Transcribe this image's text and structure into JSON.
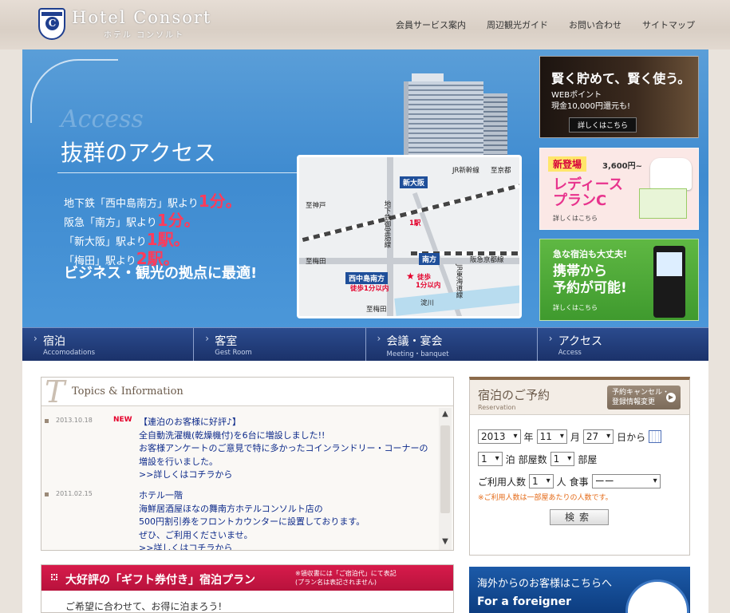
{
  "header": {
    "logo_text": "Hotel Consort",
    "logo_sub": "ホテル コンソルト",
    "nav": [
      "会員サービス案内",
      "周辺観光ガイド",
      "お問い合わせ",
      "サイトマップ"
    ]
  },
  "hero": {
    "script_word": "Access",
    "title": "抜群のアクセス",
    "lines": [
      {
        "pre": "地下鉄「西中島南方」駅より",
        "big": "1分。"
      },
      {
        "pre": "阪急「南方」駅より",
        "big": "1分。"
      },
      {
        "pre": "「新大阪」駅より",
        "big": "1駅。"
      },
      {
        "pre": "「梅田」駅より",
        "big": "2駅。"
      }
    ],
    "tagline": "ビジネス・観光の拠点に最適!",
    "map": {
      "shin_osaka": "新大阪",
      "jr_shinkansen": "JR新幹線",
      "to_kyoto": "至京都",
      "to_kobe": "至神戸",
      "to_umeda_left": "至梅田",
      "subway": "地下鉄御堂筋線",
      "one_station": "1駅",
      "minamikata": "南方",
      "hankyu": "阪急京都線",
      "jr_tokaido": "JR東海道線",
      "nishinakajima": "西中島南方",
      "walk1": "徒歩1分以内",
      "walk2_a": "徒歩",
      "walk2_b": "1分以内",
      "to_umeda_bottom": "至梅田",
      "yodogawa": "淀川"
    }
  },
  "banners": {
    "b1": {
      "title": "賢く貯めて、賢く使う。",
      "line1": "WEBポイント",
      "line2": "現金10,000円還元も!",
      "more": "詳しくはこちら"
    },
    "b2": {
      "badge": "新登場",
      "price": "3,600円~",
      "line1": "レディース",
      "line2": "プランC",
      "more": "詳しくはこちら"
    },
    "b3": {
      "title": "急な宿泊も大丈夫!",
      "line1": "携帯から",
      "line2": "予約が可能!",
      "more": "詳しくはこちら"
    }
  },
  "navbar": [
    {
      "jp": "宿泊",
      "en": "Accomodations"
    },
    {
      "jp": "客室",
      "en": "Gest Room"
    },
    {
      "jp": "会議・宴会",
      "en": "Meeting・banquet"
    },
    {
      "jp": "アクセス",
      "en": "Access"
    }
  ],
  "topics": {
    "title": "Topics & Information",
    "items": [
      {
        "date": "2013.10.18",
        "new": "NEW",
        "lines": [
          "【連泊のお客様に好評♪】",
          "全自動洗濯機(乾燥機付)を6台に増設しました!!",
          "お客様アンケートのご意見で特に多かったコインランドリー・コーナーの",
          "増設を行いました。",
          ">>詳しくはコチラから"
        ]
      },
      {
        "date": "2011.02.15",
        "new": "",
        "lines": [
          "ホテル一階",
          "海鮮居酒屋ほなの舞南方ホテルコンソルト店の",
          "500円割引券をフロントカウンターに設置しております。",
          "ぜひ、ご利用くださいませ。",
          ">>詳しくはコチラから"
        ]
      }
    ]
  },
  "gift": {
    "title": "大好評の「ギフト券付き」宿泊プラン",
    "note1": "※領収書には「ご宿泊代」にて表記",
    "note2": "(プラン名は表記されません)",
    "sub": "ご希望に合わせて、お得に泊まろう!"
  },
  "reservation": {
    "title": "宿泊のご予約",
    "sub": "Reservation",
    "cancel_line1": "予約キャンセル・",
    "cancel_line2": "登録情報変更",
    "year": "2013",
    "year_label": "年",
    "month": "11",
    "month_label": "月",
    "day": "27",
    "day_label": "日から",
    "nights": "1",
    "nights_label": "泊",
    "rooms_label": "部屋数",
    "rooms": "1",
    "rooms_unit": "部屋",
    "guests_label": "ご利用人数",
    "guests": "1",
    "guests_unit": "人",
    "meal_label": "食事",
    "meal": "ーー",
    "note": "※ご利用人数は一部屋あたりの人数です。",
    "search": "検索"
  },
  "foreigner": {
    "title": "海外からのお客様はこちらへ",
    "en": "For a foreigner"
  }
}
